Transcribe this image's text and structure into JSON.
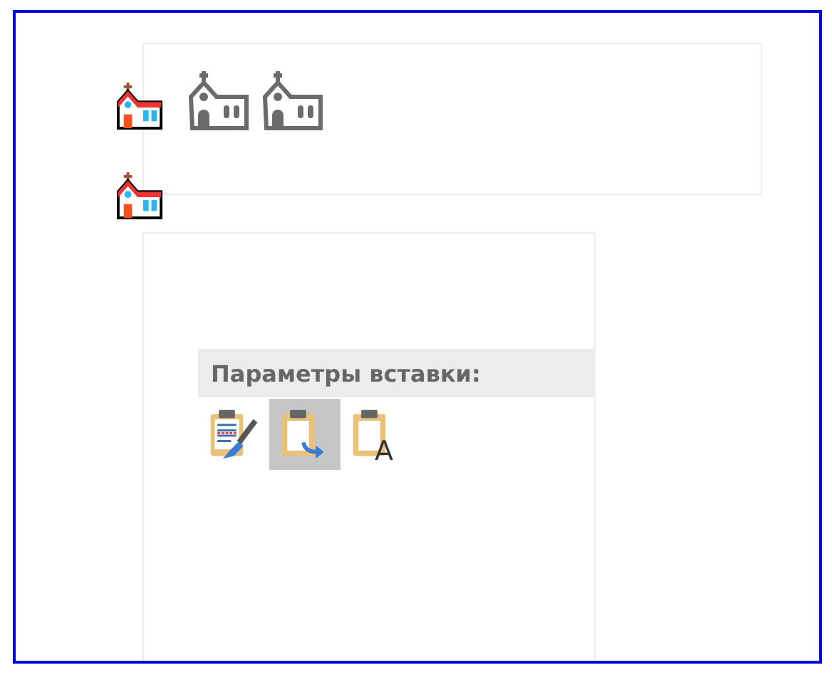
{
  "churches": [
    {
      "kind": "color"
    },
    {
      "kind": "outline"
    },
    {
      "kind": "outline"
    }
  ],
  "second_church": {
    "kind": "color"
  },
  "paste_menu": {
    "title": "Параметры вставки:",
    "options": [
      {
        "kind": "keep-formatting",
        "selected": false
      },
      {
        "kind": "merge",
        "selected": true
      },
      {
        "kind": "text-only",
        "selected": false,
        "glyph": "A"
      }
    ]
  }
}
